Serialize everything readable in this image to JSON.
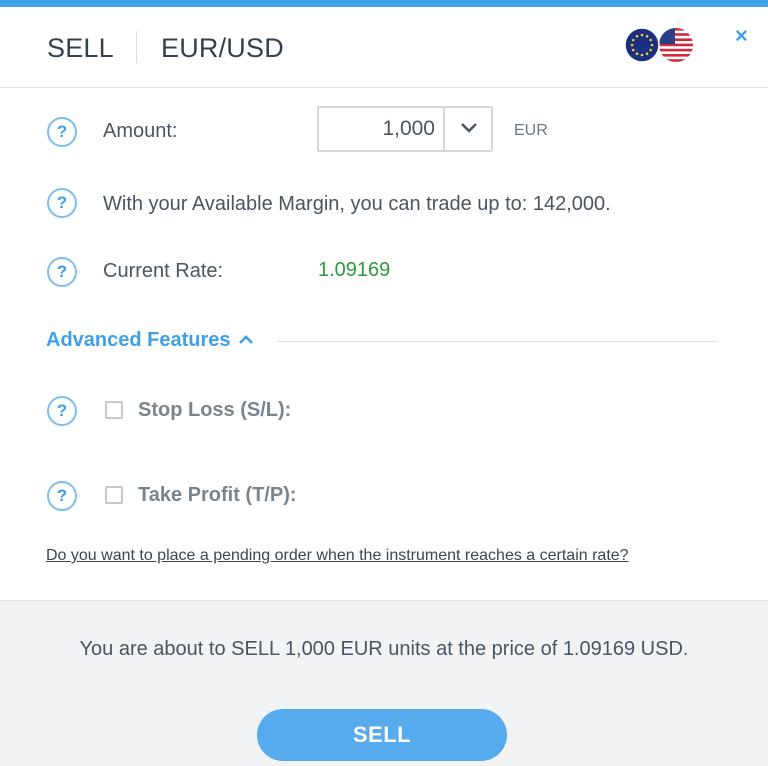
{
  "header": {
    "action": "SELL",
    "pair": "EUR/USD",
    "close_icon": "×"
  },
  "amount": {
    "label": "Amount:",
    "value": "1,000",
    "unit": "EUR"
  },
  "margin": {
    "text": "With your Available Margin, you can trade up to: 142,000."
  },
  "rate": {
    "label": "Current Rate:",
    "value": "1.09169"
  },
  "advanced": {
    "label": "Advanced Features"
  },
  "stop_loss": {
    "label": "Stop Loss (S/L):",
    "checked": false
  },
  "take_profit": {
    "label": "Take Profit (T/P):",
    "checked": false
  },
  "pending_link": "Do you want to place a pending order when the instrument reaches a certain rate?",
  "footer": {
    "summary": "You are about to SELL 1,000 EUR units at the price of 1.09169 USD.",
    "button": "SELL"
  },
  "help_glyph": "?",
  "colors": {
    "accent": "#3fa0e8",
    "rate_green": "#2e9b3e",
    "button": "#56aaee"
  },
  "icons": {
    "flags": "eur-usd-flags-icon",
    "help": "question-circle-icon",
    "dropdown": "chevron-down-icon",
    "advanced": "chevron-up-icon"
  }
}
